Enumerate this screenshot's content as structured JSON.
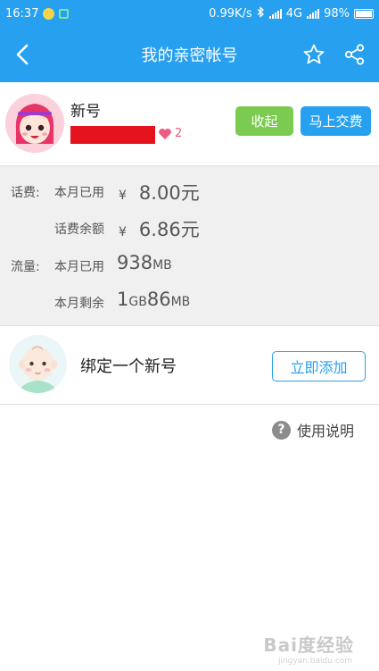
{
  "status_bar": {
    "time": "16:37",
    "network_speed": "0.99K/s",
    "network_type": "4G",
    "battery": "98%",
    "icons": [
      "app-notification-icon",
      "app-notification-icon-2",
      "bluetooth-icon",
      "signal-icon",
      "battery-icon"
    ]
  },
  "header": {
    "title": "我的亲密帐号",
    "back_icon": "back-chevron-icon",
    "favorite_icon": "star-outline-icon",
    "share_icon": "share-icon"
  },
  "account": {
    "name": "新号",
    "heart_count": "2",
    "collapse_label": "收起",
    "pay_label": "马上交费",
    "colors": {
      "collapse": "#7ccb51",
      "pay": "#27a0f0",
      "redaction": "#e5131d"
    }
  },
  "usage": {
    "fee_category": "话费:",
    "fee_used_label": "本月已用",
    "fee_used_currency": "¥",
    "fee_used_value": "8.00",
    "fee_used_unit": "元",
    "fee_balance_label": "话费余额",
    "fee_balance_currency": "¥",
    "fee_balance_value": "6.86",
    "fee_balance_unit": "元",
    "data_category": "流量:",
    "data_used_label": "本月已用",
    "data_used_value": "938",
    "data_used_unit": "MB",
    "data_left_label": "本月剩余",
    "data_left_gb_value": "1",
    "data_left_gb_unit": "GB",
    "data_left_mb_value": "86",
    "data_left_mb_unit": "MB"
  },
  "bind": {
    "text": "绑定一个新号",
    "add_label": "立即添加"
  },
  "help": {
    "icon_glyph": "?",
    "label": "使用说明"
  },
  "watermark": {
    "text": "Bai度经验",
    "sub": "jingyan.baidu.com"
  },
  "theme": {
    "primary": "#27a0f0",
    "background_gray": "#f0f0f0"
  }
}
